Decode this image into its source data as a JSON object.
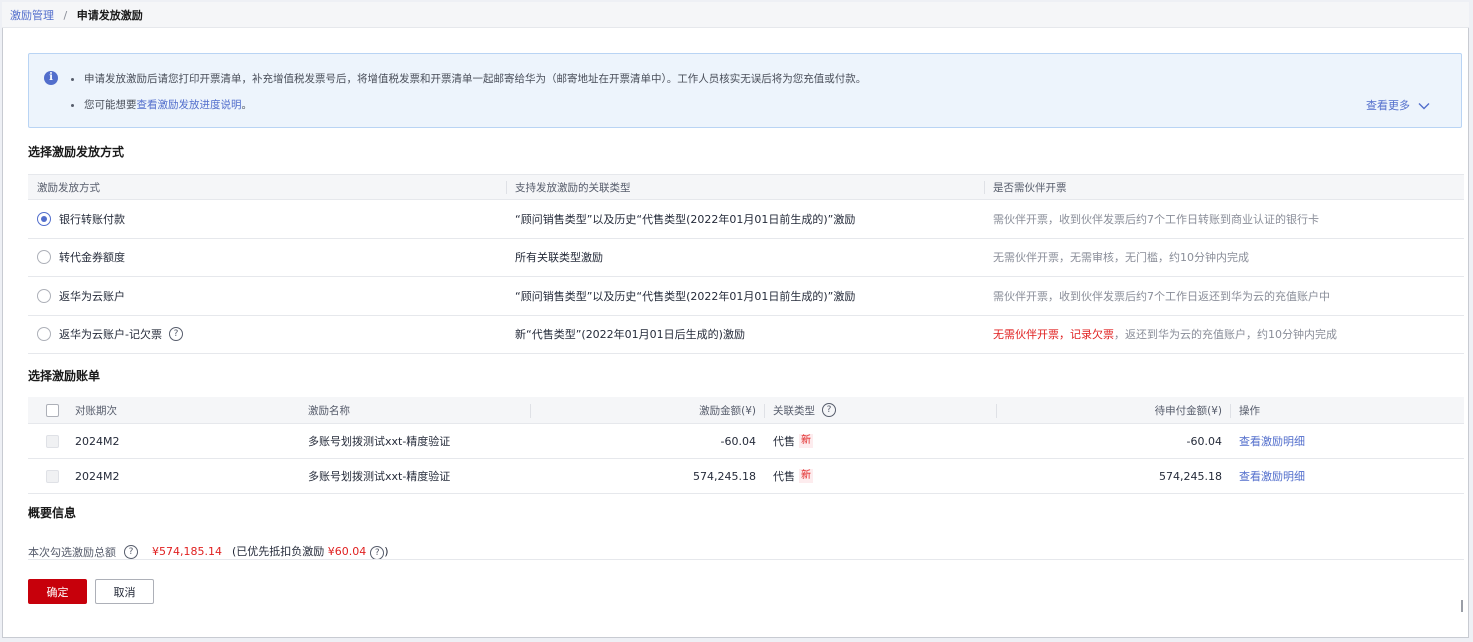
{
  "breadcrumb": {
    "parent": "激励管理",
    "separator": "/",
    "current": "申请发放激励"
  },
  "notice": {
    "line1": "申请发放激励后请您打印开票清单，补充增值税发票号后，将增值税发票和开票清单一起邮寄给华为（邮寄地址在开票清单中）。工作人员核实无误后将为您充值或付款。",
    "line2_prefix": "您可能想要",
    "line2_link": "查看激励发放进度说明",
    "line2_suffix": "。",
    "more": "查看更多"
  },
  "method_section": {
    "title": "选择激励发放方式",
    "headers": [
      "激励发放方式",
      "支持发放激励的关联类型",
      "是否需伙伴开票"
    ],
    "rows": [
      {
        "name": "银行转账付款",
        "types": "“顾问销售类型”以及历史“代售类型(2022年01月01日前生成的)”激励",
        "invoice": "需伙伴开票，收到伙伴发票后约7个工作日转账到商业认证的银行卡",
        "checked": true
      },
      {
        "name": "转代金券额度",
        "types": "所有关联类型激励",
        "invoice": "无需伙伴开票，无需审核，无门槛，约10分钟内完成",
        "checked": false
      },
      {
        "name": "返华为云账户",
        "types": "“顾问销售类型”以及历史“代售类型(2022年01月01日前生成的)”激励",
        "invoice": "需伙伴开票，收到伙伴发票后约7个工作日返还到华为云的充值账户中",
        "checked": false
      },
      {
        "name": "返华为云账户-记欠票",
        "types": "新“代售类型”(2022年01月01日后生成的)激励",
        "invoice_red": "无需伙伴开票，记录欠票",
        "invoice_rest": "，返还到华为云的充值账户，约10分钟内完成",
        "checked": false
      }
    ]
  },
  "bill_section": {
    "title": "选择激励账单",
    "headers": {
      "period": "对账期次",
      "name": "激励名称",
      "amount": "激励金额(¥)",
      "type": "关联类型",
      "pending": "待申付金额(¥)",
      "action": "操作"
    },
    "rows": [
      {
        "period": "2024M2",
        "name": "多账号划拨测试xxt-精度验证",
        "amount": "-60.04",
        "type": "代售",
        "badge": "新",
        "pending": "-60.04",
        "action": "查看激励明细"
      },
      {
        "period": "2024M2",
        "name": "多账号划拨测试xxt-精度验证",
        "amount": "574,245.18",
        "type": "代售",
        "badge": "新",
        "pending": "574,245.18",
        "action": "查看激励明细"
      }
    ]
  },
  "summary": {
    "title": "概要信息",
    "label": "本次勾选激励总额",
    "total": "¥574,185.14",
    "note_prefix": "(已优先抵扣负激励",
    "note_amount": "¥60.04",
    "note_suffix": ")"
  },
  "buttons": {
    "confirm": "确定",
    "cancel": "取消"
  },
  "icons": {
    "info": "info-icon",
    "help": "help-icon",
    "chevron": "chevron-down-icon"
  },
  "colors": {
    "accent": "#526ecc",
    "primary_button": "#c7000b",
    "danger_text": "#e02020",
    "notice_bg": "#edf4fc"
  }
}
